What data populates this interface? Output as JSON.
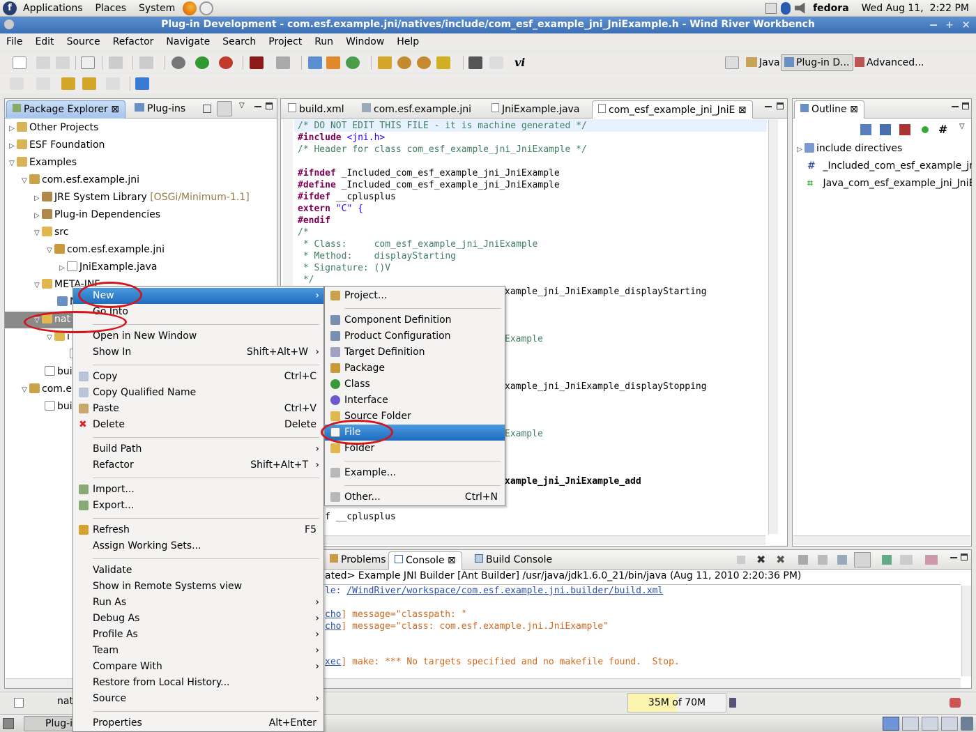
{
  "gnome": {
    "menus": [
      "Applications",
      "Places",
      "System"
    ],
    "user": "fedora",
    "clock": "Wed Aug 11,  2:22 PM"
  },
  "window": {
    "title": "Plug-in Development - com.esf.example.jni/natives/include/com_esf_example_jni_JniExample.h - Wind River Workbench"
  },
  "menubar": [
    "File",
    "Edit",
    "Source",
    "Refactor",
    "Navigate",
    "Search",
    "Project",
    "Run",
    "Window",
    "Help"
  ],
  "perspectives": [
    "Java",
    "Plug-in D...",
    "Advanced..."
  ],
  "package_explorer": {
    "tabs": [
      "Package Explorer",
      "Plug-ins"
    ],
    "rows": [
      {
        "label": "Other Projects"
      },
      {
        "label": "ESF Foundation"
      },
      {
        "label": "Examples"
      },
      {
        "label": "com.esf.example.jni"
      },
      {
        "label": "JRE System Library",
        "extra": "[OSGi/Minimum-1.1]"
      },
      {
        "label": "Plug-in Dependencies"
      },
      {
        "label": "src"
      },
      {
        "label": "com.esf.example.jni"
      },
      {
        "label": "JniExample.java"
      },
      {
        "label": "META-INF"
      },
      {
        "label": "M"
      },
      {
        "label": "nat"
      },
      {
        "label": "i"
      },
      {
        "label": "buil"
      },
      {
        "label": "com.e"
      },
      {
        "label": "buil"
      }
    ],
    "status": "nat"
  },
  "editor": {
    "tabs": [
      "build.xml",
      "com.esf.example.jni",
      "JniExample.java",
      "com_esf_example_jni_JniE"
    ],
    "lines": [
      {
        "t": "/* DO NOT EDIT THIS FILE - it is machine generated */",
        "c": "cmt"
      },
      {
        "t": "#include",
        "c": "kw",
        "rest": " <jni.h>"
      },
      {
        "t": "/* Header for class com_esf_example_jni_JniExample */",
        "c": "cmt"
      },
      {
        "t": "",
        "c": ""
      },
      {
        "t": "#ifndef",
        "c": "kw",
        "rest": " _Included_com_esf_example_jni_JniExample"
      },
      {
        "t": "#define",
        "c": "kw",
        "rest": " _Included_com_esf_example_jni_JniExample"
      },
      {
        "t": "#ifdef",
        "c": "kw",
        "rest": " __cplusplus"
      },
      {
        "t": "extern",
        "c": "kw",
        "rest": " \"C\" {"
      },
      {
        "t": "#endif",
        "c": "kw",
        "rest": ""
      },
      {
        "t": "/*",
        "c": "cmt"
      },
      {
        "t": " * Class:     com_esf_example_jni_JniExample",
        "c": "cmt"
      },
      {
        "t": " * Method:    displayStarting",
        "c": "cmt"
      },
      {
        "t": " * Signature: ()V",
        "c": "cmt"
      },
      {
        "t": " */",
        "c": "cmt"
      }
    ],
    "partial_lines": [
      {
        "t": "xample_jni_JniExample_displayStarting",
        "bold": false
      },
      {
        "t": "Example",
        "cls": "cmt"
      },
      {
        "t": "xample_jni_JniExample_displayStopping",
        "bold": false
      },
      {
        "t": "Example",
        "cls": "cmt"
      },
      {
        "t": "xample_jni_JniExample_add",
        "bold": true
      },
      {
        "t": "f __cplusplus",
        "bold": false
      }
    ]
  },
  "outline": {
    "tab": "Outline",
    "items": [
      "include directives",
      "_Included_com_esf_example_jn",
      "Java_com_esf_example_jni_JniE"
    ]
  },
  "console": {
    "tabs": [
      "Problems",
      "Console",
      "Build Console"
    ],
    "header": "ated> Example JNI Builder [Ant Builder] /usr/java/jdk1.6.0_21/bin/java (Aug 11, 2010 2:20:36 PM)",
    "file_prefix": "le: ",
    "file_link": "/WindRiver/workspace/com.esf.example.jni.builder/build.xml",
    "lines": [
      {
        "tag": "cho",
        "msg": "] message=\"classpath: \""
      },
      {
        "tag": "cho",
        "msg": "] message=\"class: com.esf.example.jni.JniExample\""
      },
      {
        "tag": "xec",
        "msg": "] make: *** No targets specified and no makefile found.  Stop."
      }
    ]
  },
  "status": {
    "heap": "35M of 70M"
  },
  "taskbar": {
    "item": "Plug-i"
  },
  "context_menu": {
    "items": [
      {
        "label": "New",
        "arrow": true,
        "selected": true
      },
      {
        "label": "Go Into"
      },
      {
        "sep": true
      },
      {
        "label": "Open in New Window"
      },
      {
        "label": "Show In",
        "shortcut": "Shift+Alt+W",
        "arrow": true
      },
      {
        "sep": true
      },
      {
        "label": "Copy",
        "shortcut": "Ctrl+C",
        "icon": "copy-icon"
      },
      {
        "label": "Copy Qualified Name",
        "icon": "copy-icon"
      },
      {
        "label": "Paste",
        "shortcut": "Ctrl+V",
        "icon": "paste-icon"
      },
      {
        "label": "Delete",
        "shortcut": "Delete",
        "icon": "delete-icon"
      },
      {
        "sep": true
      },
      {
        "label": "Build Path",
        "arrow": true
      },
      {
        "label": "Refactor",
        "shortcut": "Shift+Alt+T",
        "arrow": true
      },
      {
        "sep": true
      },
      {
        "label": "Import...",
        "icon": "import-icon"
      },
      {
        "label": "Export...",
        "icon": "export-icon"
      },
      {
        "sep": true
      },
      {
        "label": "Refresh",
        "shortcut": "F5",
        "icon": "refresh-icon"
      },
      {
        "label": "Assign Working Sets..."
      },
      {
        "sep": true
      },
      {
        "label": "Validate"
      },
      {
        "label": "Show in Remote Systems view"
      },
      {
        "label": "Run As",
        "arrow": true
      },
      {
        "label": "Debug As",
        "arrow": true
      },
      {
        "label": "Profile As",
        "arrow": true
      },
      {
        "label": "Team",
        "arrow": true
      },
      {
        "label": "Compare With",
        "arrow": true
      },
      {
        "label": "Restore from Local History..."
      },
      {
        "label": "Source",
        "arrow": true
      },
      {
        "sep": true
      },
      {
        "label": "Properties",
        "shortcut": "Alt+Enter"
      }
    ]
  },
  "new_submenu": {
    "items": [
      {
        "label": "Project...",
        "icon": "project-icon"
      },
      {
        "sep": true
      },
      {
        "label": "Component Definition",
        "icon": "component-icon"
      },
      {
        "label": "Product Configuration",
        "icon": "product-icon"
      },
      {
        "label": "Target Definition",
        "icon": "target-icon"
      },
      {
        "label": "Package",
        "icon": "package-icon"
      },
      {
        "label": "Class",
        "icon": "class-icon"
      },
      {
        "label": "Interface",
        "icon": "interface-icon"
      },
      {
        "label": "Source Folder",
        "icon": "source-folder-icon"
      },
      {
        "label": "File",
        "icon": "file-icon",
        "selected": true
      },
      {
        "label": "Folder",
        "icon": "folder-icon"
      },
      {
        "sep": true
      },
      {
        "label": "Example...",
        "icon": "example-icon"
      },
      {
        "sep": true
      },
      {
        "label": "Other...",
        "shortcut": "Ctrl+N",
        "icon": "other-icon"
      }
    ]
  },
  "colors": {
    "title_bar": "#3c6fb4",
    "selection": "#1f6cbf",
    "annotation": "#d3151c",
    "comment": "#3f7f5f",
    "keyword": "#7f0055"
  }
}
